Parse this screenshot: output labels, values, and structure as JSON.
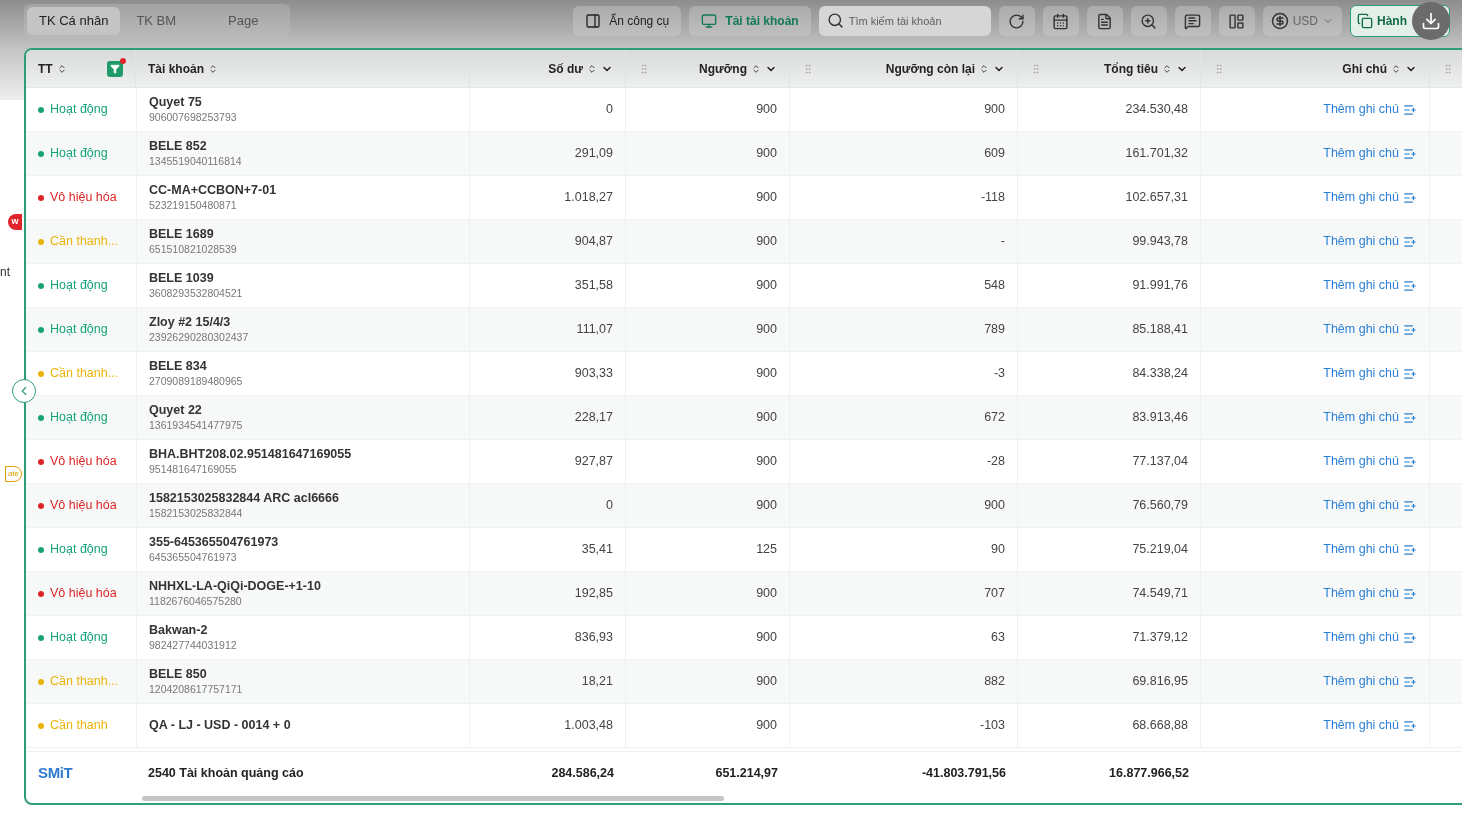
{
  "tabs": [
    {
      "label": "TK Cá nhân",
      "selected": true
    },
    {
      "label": "TK BM",
      "selected": false
    },
    {
      "label": "Page",
      "selected": false
    }
  ],
  "toolbar": {
    "hide_tools": "Ẩn công cụ",
    "download_accounts": "Tải tài khoản",
    "search": {
      "placeholder": "Tìm kiếm tài khoản"
    },
    "currency": "USD",
    "action": "Hành"
  },
  "sidebar_fragments": [
    {
      "kind": "badge",
      "text": "w"
    },
    {
      "kind": "text",
      "text": "nt"
    },
    {
      "kind": "pill",
      "text": "ate"
    }
  ],
  "table": {
    "columns": [
      {
        "label": "TT",
        "sort": true,
        "menu": false,
        "grip": false
      },
      {
        "label": "Tài khoản",
        "sort": true,
        "menu": false,
        "grip": false
      },
      {
        "label": "Số dư",
        "sort": true,
        "menu": true,
        "grip": false
      },
      {
        "label": "Ngưỡng",
        "sort": true,
        "menu": true,
        "grip": true
      },
      {
        "label": "Ngưỡng còn lại",
        "sort": true,
        "menu": true,
        "grip": true
      },
      {
        "label": "Tổng tiêu",
        "sort": true,
        "menu": true,
        "grip": true
      },
      {
        "label": "Ghi chú",
        "sort": true,
        "menu": true,
        "grip": true
      }
    ],
    "rows": [
      {
        "status": "Hoạt động",
        "color": "#16a37a",
        "name": "Quyet 75",
        "id": "906007698253793",
        "balance": "0",
        "threshold": "900",
        "remaining": "900",
        "spent": "234.530,48",
        "note": "Thêm ghi chú"
      },
      {
        "status": "Hoạt động",
        "color": "#16a37a",
        "name": "BELE 852",
        "id": "1345519040116814",
        "balance": "291,09",
        "threshold": "900",
        "remaining": "609",
        "spent": "161.701,32",
        "note": "Thêm ghi chú"
      },
      {
        "status": "Vô hiệu hóa",
        "color": "#dc2626",
        "name": "CC-MA+CCBON+7-01",
        "id": "523219150480871",
        "balance": "1.018,27",
        "threshold": "900",
        "remaining": "-118",
        "spent": "102.657,31",
        "note": "Thêm ghi chú"
      },
      {
        "status": "Cần thanh...",
        "color": "#eab308",
        "name": "BELE 1689",
        "id": "651510821028539",
        "balance": "904,87",
        "threshold": "900",
        "remaining": "-",
        "spent": "99.943,78",
        "note": "Thêm ghi chú"
      },
      {
        "status": "Hoạt động",
        "color": "#16a37a",
        "name": "BELE 1039",
        "id": "3608293532804521",
        "balance": "351,58",
        "threshold": "900",
        "remaining": "548",
        "spent": "91.991,76",
        "note": "Thêm ghi chú"
      },
      {
        "status": "Hoạt động",
        "color": "#16a37a",
        "name": "Zloy #2 15/4/3",
        "id": "23926290280302437",
        "balance": "111,07",
        "threshold": "900",
        "remaining": "789",
        "spent": "85.188,41",
        "note": "Thêm ghi chú"
      },
      {
        "status": "Cần thanh...",
        "color": "#eab308",
        "name": "BELE 834",
        "id": "2709089189480965",
        "balance": "903,33",
        "threshold": "900",
        "remaining": "-3",
        "spent": "84.338,24",
        "note": "Thêm ghi chú"
      },
      {
        "status": "Hoạt động",
        "color": "#16a37a",
        "name": "Quyet 22",
        "id": "1361934541477975",
        "balance": "228,17",
        "threshold": "900",
        "remaining": "672",
        "spent": "83.913,46",
        "note": "Thêm ghi chú"
      },
      {
        "status": "Vô hiệu hóa",
        "color": "#dc2626",
        "name": "BHA.BHT208.02.951481647169055",
        "id": "951481647169055",
        "balance": "927,87",
        "threshold": "900",
        "remaining": "-28",
        "spent": "77.137,04",
        "note": "Thêm ghi chú"
      },
      {
        "status": "Vô hiệu hóa",
        "color": "#dc2626",
        "name": "1582153025832844 ARC acl6666",
        "id": "1582153025832844",
        "balance": "0",
        "threshold": "900",
        "remaining": "900",
        "spent": "76.560,79",
        "note": "Thêm ghi chú"
      },
      {
        "status": "Hoạt động",
        "color": "#16a37a",
        "name": "355-645365504761973",
        "id": "645365504761973",
        "balance": "35,41",
        "threshold": "125",
        "remaining": "90",
        "spent": "75.219,04",
        "note": "Thêm ghi chú"
      },
      {
        "status": "Vô hiệu hóa",
        "color": "#dc2626",
        "name": "NHHXL-LA-QiQi-DOGE-+1-10",
        "id": "1182676046575280",
        "balance": "192,85",
        "threshold": "900",
        "remaining": "707",
        "spent": "74.549,71",
        "note": "Thêm ghi chú"
      },
      {
        "status": "Hoạt động",
        "color": "#16a37a",
        "name": "Bakwan-2",
        "id": "982427744031912",
        "balance": "836,93",
        "threshold": "900",
        "remaining": "63",
        "spent": "71.379,12",
        "note": "Thêm ghi chú"
      },
      {
        "status": "Cần thanh...",
        "color": "#eab308",
        "name": "BELE 850",
        "id": "1204208617757171",
        "balance": "18,21",
        "threshold": "900",
        "remaining": "882",
        "spent": "69.816,95",
        "note": "Thêm ghi chú"
      },
      {
        "status": "Cần thanh",
        "color": "#eab308",
        "name": "QA - LJ - USD - 0014 + 0",
        "balance": "1.003,48",
        "threshold": "900",
        "remaining": "-103",
        "spent": "68.668,88",
        "note": "Thêm ghi chú"
      }
    ],
    "footer": {
      "logo": "SMiT",
      "total_label": "2540 Tài khoản quảng cáo",
      "balance": "284.586,24",
      "threshold": "651.214,97",
      "remaining": "-41.803.791,56",
      "spent": "16.877.966,52"
    }
  }
}
